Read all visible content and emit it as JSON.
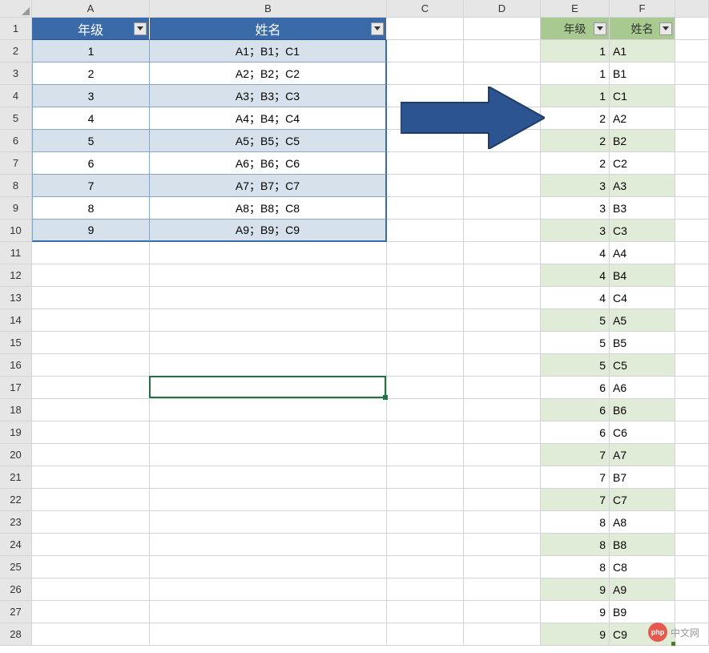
{
  "columns": [
    "A",
    "B",
    "C",
    "D",
    "E",
    "F",
    ""
  ],
  "row_numbers": [
    1,
    2,
    3,
    4,
    5,
    6,
    7,
    8,
    9,
    10,
    11,
    12,
    13,
    14,
    15,
    16,
    17,
    18,
    19,
    20,
    21,
    22,
    23,
    24,
    25,
    26,
    27,
    28
  ],
  "table1": {
    "headers": {
      "col_a": "年级",
      "col_b": "姓名"
    },
    "rows": [
      {
        "a": "1",
        "b": "A1；B1；C1"
      },
      {
        "a": "2",
        "b": "A2；B2；C2"
      },
      {
        "a": "3",
        "b": "A3；B3；C3"
      },
      {
        "a": "4",
        "b": "A4；B4；C4"
      },
      {
        "a": "5",
        "b": "A5；B5；C5"
      },
      {
        "a": "6",
        "b": "A6；B6；C6"
      },
      {
        "a": "7",
        "b": "A7；B7；C7"
      },
      {
        "a": "8",
        "b": "A8；B8；C8"
      },
      {
        "a": "9",
        "b": "A9；B9；C9"
      }
    ]
  },
  "table2": {
    "headers": {
      "col_e": "年级",
      "col_f": "姓名"
    },
    "rows": [
      {
        "e": "1",
        "f": "A1"
      },
      {
        "e": "1",
        "f": "B1"
      },
      {
        "e": "1",
        "f": "C1"
      },
      {
        "e": "2",
        "f": "A2"
      },
      {
        "e": "2",
        "f": "B2"
      },
      {
        "e": "2",
        "f": "C2"
      },
      {
        "e": "3",
        "f": "A3"
      },
      {
        "e": "3",
        "f": "B3"
      },
      {
        "e": "3",
        "f": "C3"
      },
      {
        "e": "4",
        "f": "A4"
      },
      {
        "e": "4",
        "f": "B4"
      },
      {
        "e": "4",
        "f": "C4"
      },
      {
        "e": "5",
        "f": "A5"
      },
      {
        "e": "5",
        "f": "B5"
      },
      {
        "e": "5",
        "f": "C5"
      },
      {
        "e": "6",
        "f": "A6"
      },
      {
        "e": "6",
        "f": "B6"
      },
      {
        "e": "6",
        "f": "C6"
      },
      {
        "e": "7",
        "f": "A7"
      },
      {
        "e": "7",
        "f": "B7"
      },
      {
        "e": "7",
        "f": "C7"
      },
      {
        "e": "8",
        "f": "A8"
      },
      {
        "e": "8",
        "f": "B8"
      },
      {
        "e": "8",
        "f": "C8"
      },
      {
        "e": "9",
        "f": "A9"
      },
      {
        "e": "9",
        "f": "B9"
      },
      {
        "e": "9",
        "f": "C9"
      }
    ]
  },
  "selected_cell": {
    "row": 17,
    "col": "B"
  },
  "watermark": {
    "logo_text": "php",
    "text": "中文网"
  },
  "arrow_color_fill": "#2c5490",
  "arrow_color_stroke": "#1f3d68"
}
